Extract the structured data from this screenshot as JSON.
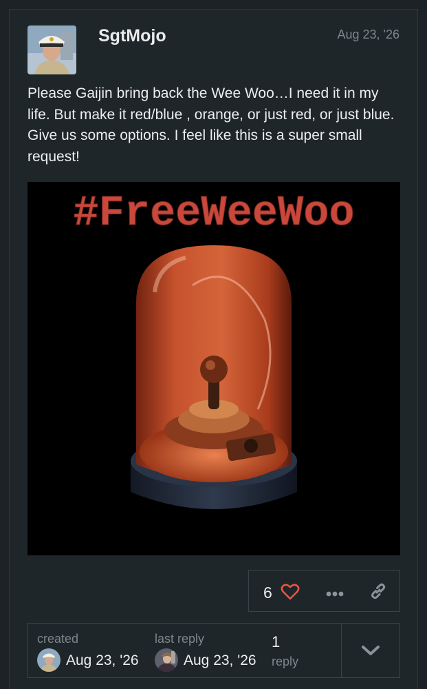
{
  "post": {
    "username": "SgtMojo",
    "date": "Aug 23, '26",
    "body": "Please Gaijin bring back the Wee Woo…I need it in my life. But make it red/blue , orange, or just red, or just blue. Give us some options. I feel like this is a super small request!",
    "image": {
      "headline": "#FreeWeeWoo"
    }
  },
  "actions": {
    "like_count": "6",
    "heart_icon": "heart-icon",
    "more_icon": "ellipsis-icon",
    "link_icon": "link-icon",
    "heart_color": "#e45745"
  },
  "topic_map": {
    "created_label": "created",
    "created_date": "Aug 23, '26",
    "last_reply_label": "last reply",
    "last_reply_date": "Aug 23, '26",
    "reply_count": "1",
    "reply_label": "reply",
    "expand_icon": "chevron-down-icon"
  },
  "colors": {
    "background": "#1f2629",
    "text": "#eceeef",
    "muted": "#7c878c",
    "border": "#3a4448",
    "headline": "#c9483b"
  }
}
